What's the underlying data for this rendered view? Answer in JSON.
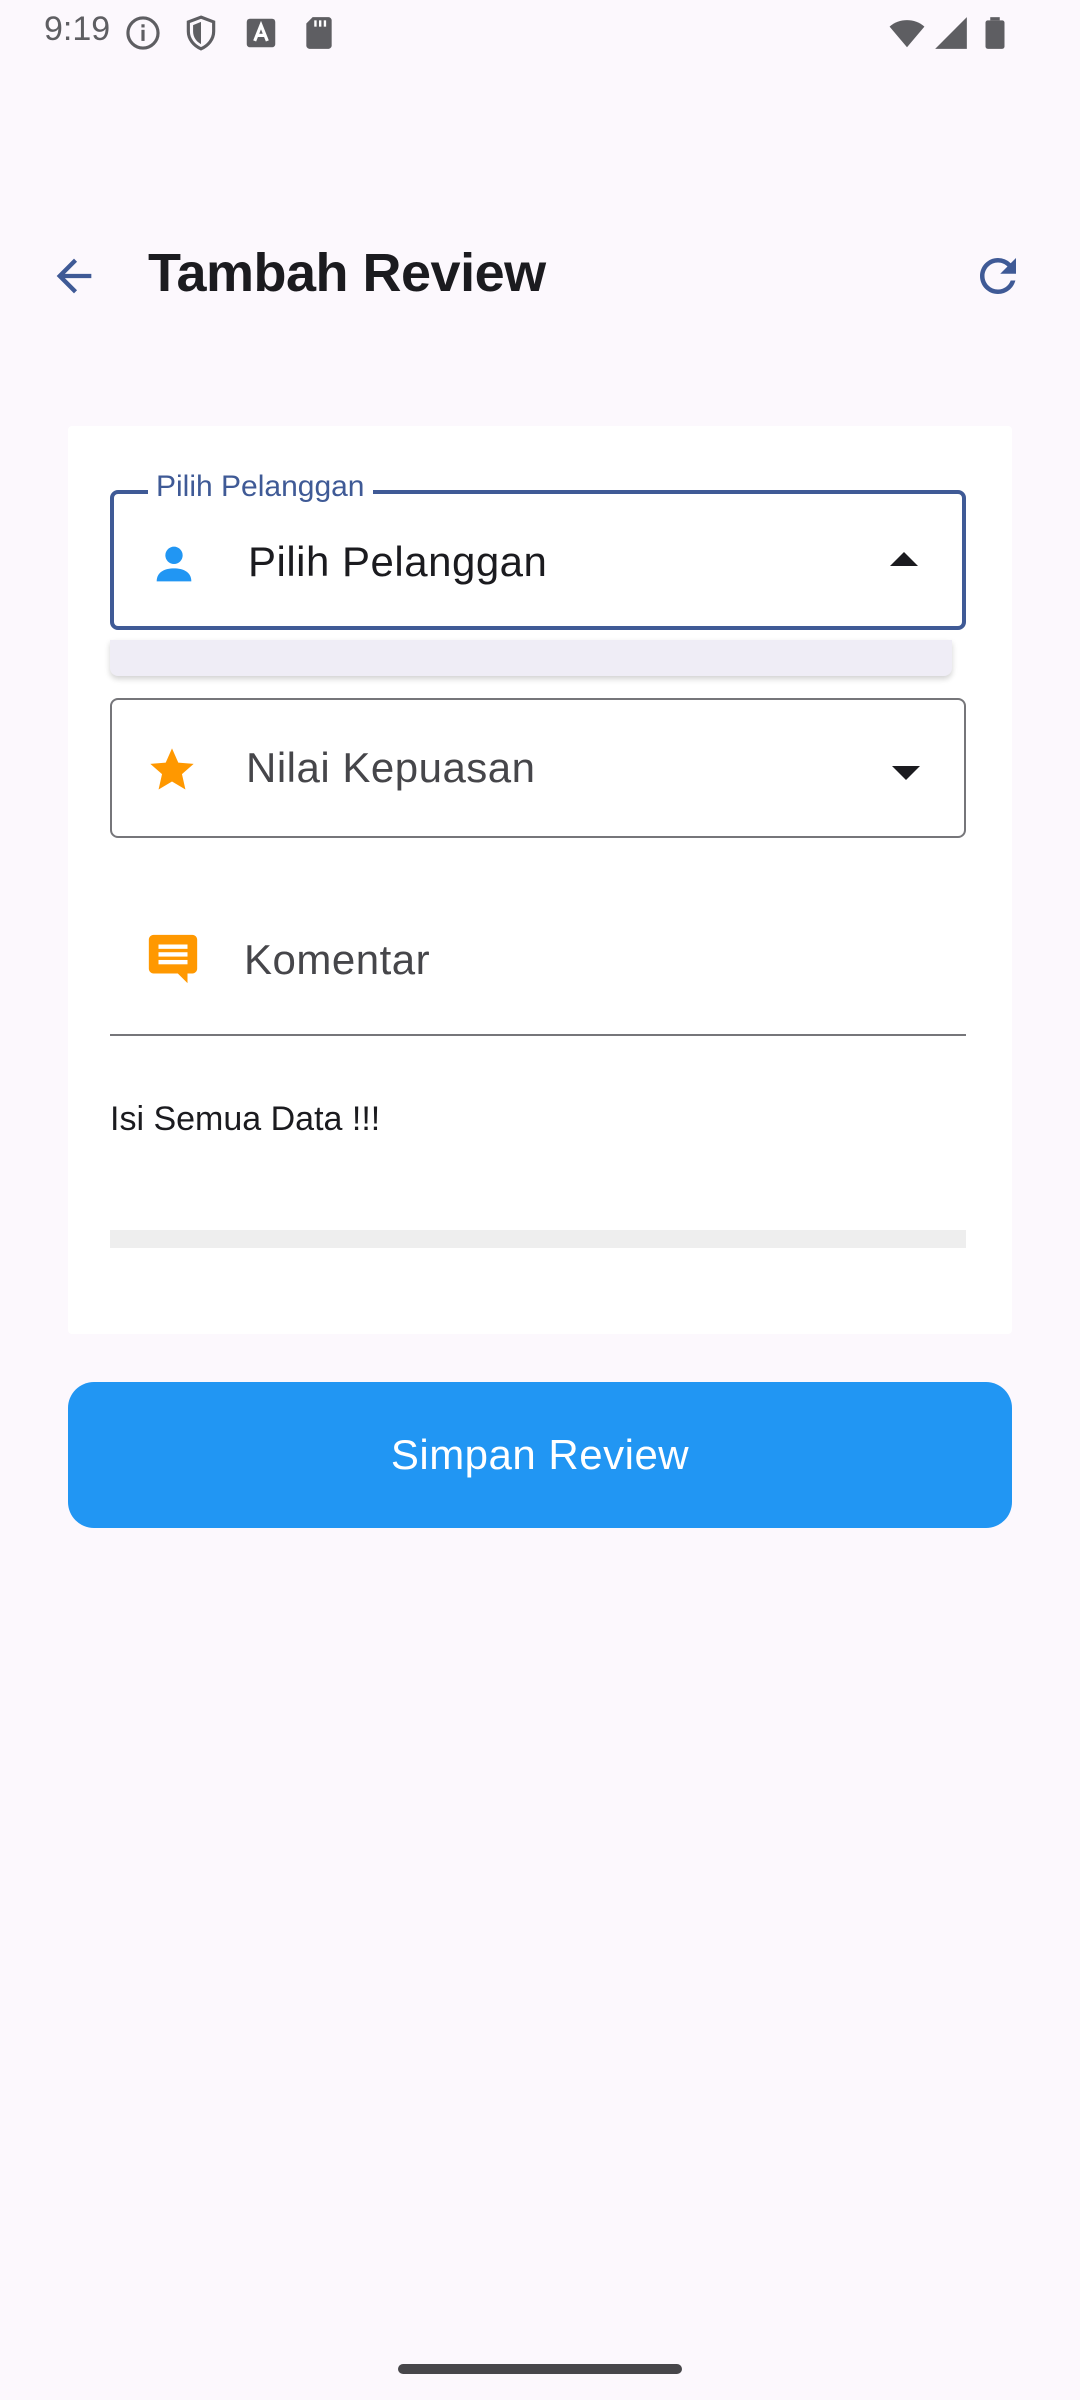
{
  "status_bar": {
    "time": "9:19"
  },
  "appbar": {
    "title": "Tambah Review",
    "back_icon": "arrow-back-icon",
    "refresh_icon": "refresh-icon"
  },
  "form": {
    "customer_dropdown": {
      "label": "Pilih Pelanggan",
      "value": "Pilih Pelanggan",
      "icon": "person-icon",
      "icon_color": "#2196f3"
    },
    "rating_dropdown": {
      "value": "Nilai Kepuasan",
      "icon": "star-icon",
      "icon_color": "#ff9800"
    },
    "comment_field": {
      "placeholder": "Komentar",
      "icon": "comment-icon",
      "icon_color": "#ff9800"
    },
    "error_message": "Isi Semua Data !!!"
  },
  "save_button": {
    "label": "Simpan Review",
    "color": "#2196f3"
  },
  "colors": {
    "accent": "#3f5a96",
    "background": "#fcf8fd"
  }
}
